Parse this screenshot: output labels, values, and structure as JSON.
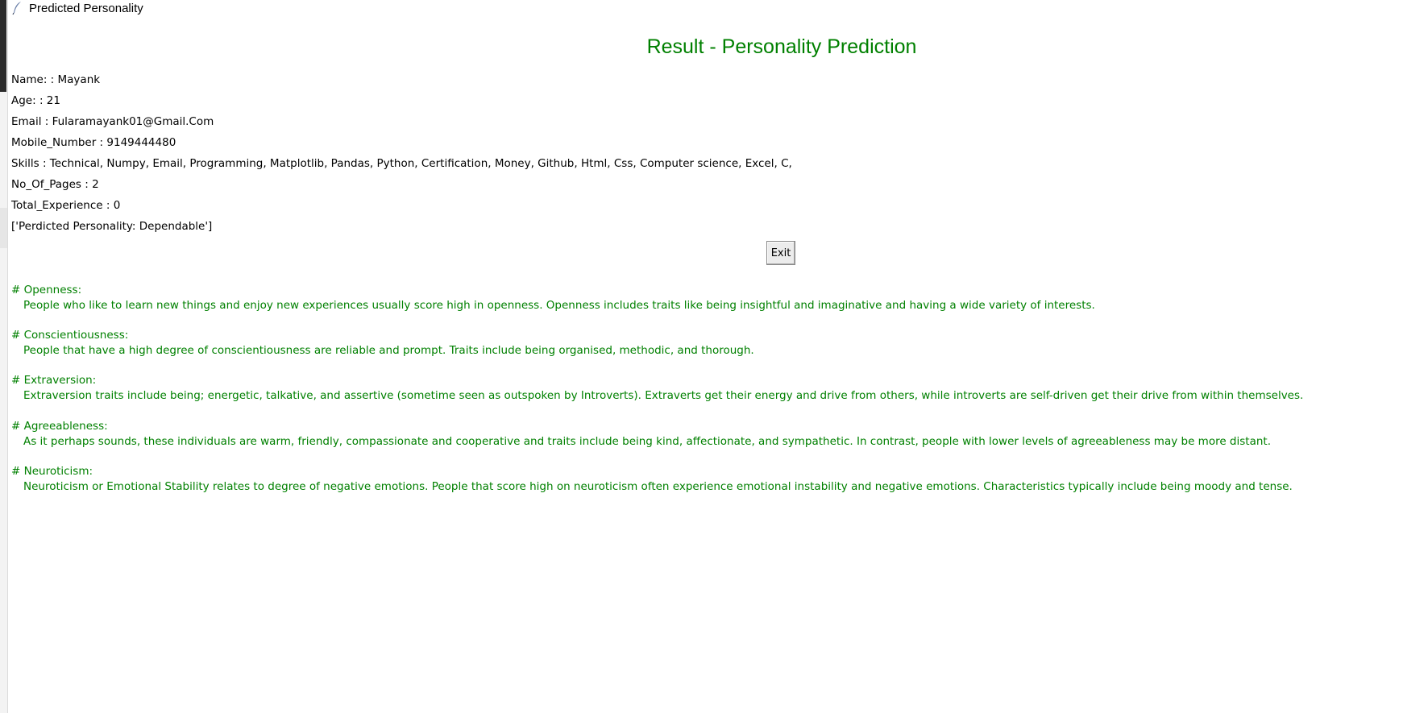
{
  "window": {
    "title": "Predicted Personality"
  },
  "header": {
    "title": "Result - Personality Prediction"
  },
  "info": {
    "name": "Name: : Mayank",
    "age": "Age: : 21",
    "email": "Email : Fularamayank01@Gmail.Com",
    "mobile": "Mobile_Number : 9149444480",
    "skills": "Skills : Technical, Numpy, Email, Programming, Matplotlib, Pandas, Python, Certification, Money, Github, Html, Css, Computer science, Excel, C,",
    "pages": "No_Of_Pages : 2",
    "experience": "Total_Experience : 0",
    "prediction": "['Perdicted Personality: Dependable']"
  },
  "buttons": {
    "exit_label": "Exit"
  },
  "traits": [
    {
      "heading": "# Openness:",
      "description": "People who like to learn new things and enjoy new experiences usually score high in openness. Openness includes traits like being insightful and imaginative and having a wide variety of interests."
    },
    {
      "heading": "# Conscientiousness:",
      "description": "People that have a high degree of conscientiousness are reliable and prompt. Traits include being organised, methodic, and thorough."
    },
    {
      "heading": "# Extraversion:",
      "description": "Extraversion traits include being; energetic, talkative, and assertive (sometime seen as outspoken by Introverts). Extraverts get their energy and drive from others, while introverts are self-driven get their drive from within themselves."
    },
    {
      "heading": "# Agreeableness:",
      "description": "As it perhaps sounds, these individuals are warm, friendly, compassionate and cooperative and traits include being kind, affectionate, and sympathetic. In contrast, people with lower levels of agreeableness may be more distant."
    },
    {
      "heading": "# Neuroticism:",
      "description": "Neuroticism or Emotional Stability relates to degree of negative emotions. People that score high on neuroticism often experience emotional instability and negative emotions. Characteristics typically include being moody and tense."
    }
  ],
  "colors": {
    "accent": "#008000",
    "text": "#000000",
    "background": "#ffffff"
  },
  "icons": {
    "window_icon": "feather-icon"
  }
}
